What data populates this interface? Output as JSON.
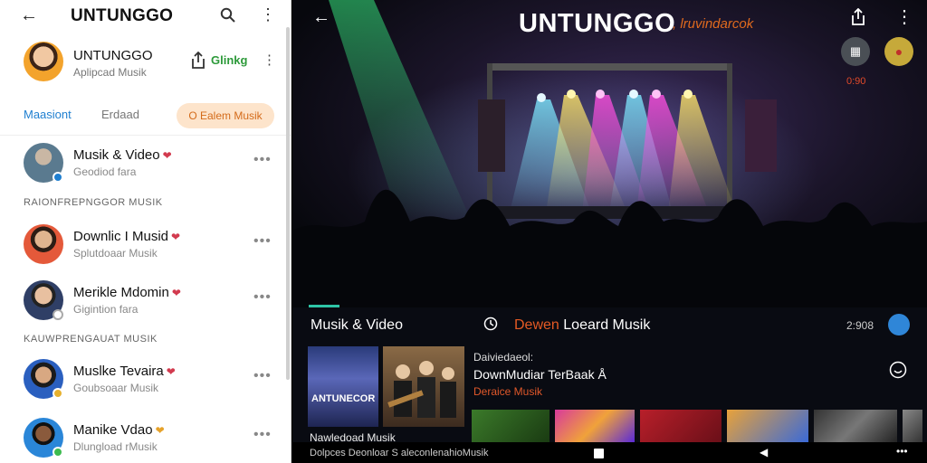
{
  "left": {
    "topbar": {
      "back_icon": "arrow-left-icon",
      "title": "UNTUNGGO"
    },
    "profile": {
      "name": "UNTUNGGO",
      "sub": "Aplipcad Musik",
      "share_label": "Glinkg"
    },
    "tabs": {
      "tab1": "Maasiont",
      "tab2": "Erdaad",
      "pill": "O Ealem Musik"
    },
    "items_top": [
      {
        "label": "Musik & Video",
        "sub": "Geodiod fara"
      }
    ],
    "section1": "RAIONFREPNGGOR MUSIK",
    "items_mid": [
      {
        "label": "Downlic I Musid",
        "sub": "Splutdoaar Musik"
      },
      {
        "label": "Merikle Mdomin",
        "sub": "Gigintion fara"
      }
    ],
    "section2": "KAUWPRENGAUAT MUSIK",
    "items_bot": [
      {
        "label": "Muslke Tevaira",
        "sub": "Goubsoaar Musik"
      },
      {
        "label": "Manike Vdao",
        "sub": "Dlungload rMusik"
      }
    ],
    "more_icon": "more-horizontal-icon",
    "heart_icon": "heart-icon"
  },
  "right": {
    "title": "UNTUNGGO",
    "subtitle": ", lruvindarcok",
    "time_top": "0:90",
    "bar": {
      "left": "Musik & Video",
      "mid_highlight": "Dewen",
      "mid_rest": "Loeard Musik",
      "time": "2:908"
    },
    "thumb1_text": "ANTUNECOR",
    "cap1": "Nawledoad Musik",
    "feature": {
      "label": "Daiviedaeol:",
      "title": "DownMudiar TerBaak Å",
      "sub": "Deraice Musik"
    },
    "bottom_text": "Dolpces Deonloar S aleconlenahioMusik"
  },
  "colors": {
    "accent_blue": "#1f7fd0",
    "accent_orange": "#e55a24",
    "accent_green": "#2d9a3a",
    "accent_teal": "#2ec4a6"
  }
}
